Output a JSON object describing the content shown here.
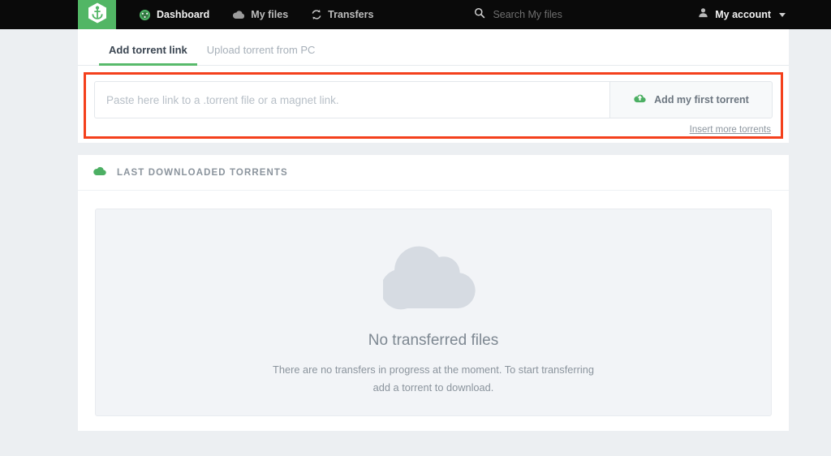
{
  "topnav": {
    "logo_icon": "anchor-hexagon-logo",
    "items": [
      {
        "label": "Dashboard",
        "icon": "speedometer-icon",
        "active": true
      },
      {
        "label": "My files",
        "icon": "cloud-icon",
        "active": false
      },
      {
        "label": "Transfers",
        "icon": "sync-arrows-icon",
        "active": false
      }
    ],
    "search": {
      "icon": "search-icon",
      "placeholder": "Search My files",
      "value": ""
    },
    "account": {
      "icon": "user-icon",
      "label": "My account",
      "caret": "chevron-down-icon"
    }
  },
  "tabs": [
    {
      "label": "Add torrent link",
      "active": true
    },
    {
      "label": "Upload torrent from PC",
      "active": false
    }
  ],
  "add_torrent": {
    "input_placeholder": "Paste here link to a .torrent file or a magnet link.",
    "input_value": "",
    "button_label": "Add my first torrent",
    "button_icon": "cloud-upload-icon",
    "insert_more_label": "Insert more torrents",
    "highlight_color": "#f4401c"
  },
  "last_downloaded": {
    "icon": "cloud-icon",
    "title": "LAST DOWNLOADED TORRENTS",
    "empty_state": {
      "illustration": "cloud-illustration",
      "title": "No transferred files",
      "description": "There are no transfers in progress at the moment. To start transferring add a torrent to download."
    }
  },
  "colors": {
    "brand_green": "#52b665",
    "accent_red": "#f4401c",
    "page_background": "#eceff2",
    "topbar_background": "#0a0a0a"
  }
}
